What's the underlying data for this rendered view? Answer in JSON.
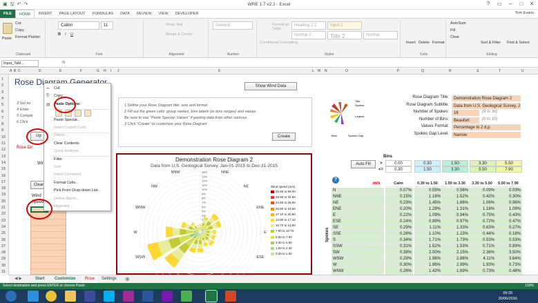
{
  "window": {
    "title": "WRE 1.7 v2.2 - Excel",
    "user": "Tom Evans"
  },
  "ribbon_tabs": [
    "FILE",
    "HOME",
    "INSERT",
    "PAGE LAYOUT",
    "FORMULAS",
    "DATA",
    "REVIEW",
    "VIEW",
    "DEVELOPER"
  ],
  "ribbon": {
    "cut": "Cut",
    "copy": "Copy",
    "paste": "Paste",
    "format_painter": "Format Painter",
    "font_name": "Calibri",
    "font_size": "11",
    "wrap_text": "Wrap Text",
    "merge": "Merge & Center",
    "number_format": "General",
    "conditional": "Conditional Formatting",
    "format_table": "Format as Table",
    "styles": [
      "Heading 2 2",
      "Input 2",
      "Normal 2",
      "Title 2",
      "Normal"
    ],
    "insert": "Insert",
    "delete": "Delete",
    "format": "Format",
    "autosum": "AutoSum",
    "fill": "Fill",
    "clear": "Clear",
    "sort_filter": "Sort & Filter",
    "find_select": "Find & Select",
    "groups": [
      "Clipboard",
      "Font",
      "Alignment",
      "Number",
      "Styles",
      "Cells",
      "Editing"
    ]
  },
  "formula_bar": {
    "name_box": "Input_Tabl...",
    "fx": "fx",
    "value": ""
  },
  "columns": [
    "A",
    "B",
    "C",
    "D",
    "E",
    "F",
    "G",
    "H",
    "I",
    "J",
    "K",
    "L",
    "M",
    "N",
    "O",
    "P",
    "Q",
    "R",
    "S",
    "T",
    "U"
  ],
  "rows": [
    "1",
    "2",
    "3",
    "4",
    "5",
    "6",
    "7",
    "8",
    "9",
    "10",
    "11",
    "12",
    "13",
    "14",
    "15",
    "16",
    "17",
    "18",
    "19",
    "20",
    "21",
    "22",
    "23",
    "24",
    "25",
    "26",
    "27",
    "28",
    "29",
    "30",
    "31"
  ],
  "sheet": {
    "title": "Rose Diagram Generator",
    "show_wind_data": "Show Wind Data",
    "left_instructions": [
      "3  Set nu",
      "4  Enter",
      "5  Comple",
      "6  Click"
    ],
    "update_button": "Up",
    "rose_dir_label": "Rose Dir",
    "wind_label": "Win",
    "clear_button": "Clear",
    "wind_header": "Wind",
    "speed_header": "Speed",
    "instructions": [
      "1  Define your Rose Diagram title, size and format",
      "2  Fill out the green cells: group names, bins labels (or bins ranges) and values",
      "    Be sure to use \"Paste Special: Values\" if pasting data from other sources",
      "3  Click \"Create\" to customize your Rose Diagram"
    ],
    "create_button": "Create"
  },
  "context_menu": {
    "items": [
      "Cut",
      "Copy",
      "Paste Options:",
      "",
      "Paste Special...",
      "Insert Copied Cells...",
      "Delete...",
      "Clear Contents",
      "Quick Analysis",
      "Filter",
      "Sort",
      "Insert Comment",
      "Format Cells...",
      "Pick From Drop-down List...",
      "Define Name...",
      "Hyperlink..."
    ],
    "disabled": [
      5,
      6,
      8,
      10,
      11,
      14,
      15
    ]
  },
  "settings": {
    "rows": [
      {
        "label": "Rose Diagram Title:",
        "value": "Demonstration Rose Diagram 2"
      },
      {
        "label": "Rose Diagram Subtitle:",
        "value": "Data from U.S. Geological Survey, Jan-01"
      },
      {
        "label": "Number of Spokes:",
        "value": "16",
        "hint": "(8 to 36)"
      },
      {
        "label": "Number of Bins:",
        "value": "Beaufort",
        "hint": "(0 to 10)"
      },
      {
        "label": "Values Format:",
        "value": "Percentage to 2 d.p."
      },
      {
        "label": "Spokes Gap Level:",
        "value": "Narrow"
      }
    ]
  },
  "bins": {
    "header": "Bins",
    "autofill": "Auto Fill",
    "gt": ">",
    "lte": "<=",
    "lower": [
      "0.00",
      "0.30",
      "1.50",
      "3.30",
      "5.50"
    ],
    "upper": [
      "0.30",
      "1.50",
      "3.30",
      "5.50",
      "7.90"
    ],
    "unit": "m/s",
    "columns": [
      "Calm",
      "0.30 to 1.50",
      "1.50 to 3.30",
      "3.30 to 5.50",
      "5.50 to 7.90"
    ],
    "spokes_label": "Spokes",
    "rows": [
      {
        "dir": "N",
        "v": [
          "0.07%",
          "0.55%",
          "0.56%",
          "0.09%",
          "0.03%"
        ]
      },
      {
        "dir": "NNE",
        "v": [
          "0.15%",
          "1.18%",
          "1.52%",
          "0.42%",
          "0.30%"
        ]
      },
      {
        "dir": "NE",
        "v": [
          "0.23%",
          "1.45%",
          "1.66%",
          "1.06%",
          "0.98%"
        ]
      },
      {
        "dir": "ENE",
        "v": [
          "0.20%",
          "1.29%",
          "1.31%",
          "1.18%",
          "1.09%"
        ]
      },
      {
        "dir": "E",
        "v": [
          "0.22%",
          "1.09%",
          "0.94%",
          "0.75%",
          "0.43%"
        ]
      },
      {
        "dir": "ESE",
        "v": [
          "0.24%",
          "0.89%",
          "0.97%",
          "0.72%",
          "0.47%"
        ]
      },
      {
        "dir": "SE",
        "v": [
          "0.29%",
          "1.11%",
          "1.33%",
          "0.63%",
          "0.27%"
        ]
      },
      {
        "dir": "SSE",
        "v": [
          "0.26%",
          "1.10%",
          "1.23%",
          "0.44%",
          "0.18%"
        ]
      },
      {
        "dir": "S",
        "v": [
          "0.34%",
          "1.71%",
          "1.73%",
          "0.53%",
          "0.53%"
        ]
      },
      {
        "dir": "SSW",
        "v": [
          "0.31%",
          "1.52%",
          "1.53%",
          "0.71%",
          "0.89%"
        ]
      },
      {
        "dir": "SW",
        "v": [
          "0.38%",
          "2.00%",
          "2.15%",
          "2.36%",
          "3.50%"
        ]
      },
      {
        "dir": "WSW",
        "v": [
          "0.29%",
          "1.98%",
          "2.88%",
          "4.11%",
          "3.64%"
        ]
      },
      {
        "dir": "W",
        "v": [
          "0.30%",
          "1.86%",
          "2.99%",
          "1.93%",
          "0.73%"
        ]
      },
      {
        "dir": "WNW",
        "v": [
          "0.26%",
          "1.42%",
          "1.69%",
          "0.73%",
          "0.48%"
        ]
      }
    ]
  },
  "chart": {
    "title": "Demonstration Rose Diagram 2",
    "subtitle": "Data from U.S. Geological Survey, Jan-01-2015 to Dec-31-2015",
    "directions": [
      "N",
      "NNE",
      "NE",
      "ENE",
      "E",
      "ESE",
      "SE",
      "SSE",
      "S",
      "SSW",
      "SW",
      "WSW",
      "W",
      "WNW",
      "NW",
      "NNW"
    ],
    "rings": [
      "14%",
      "13%",
      "12%",
      "11%",
      "10%",
      "9%",
      "8%",
      "7%",
      "6%",
      "5%",
      "4%",
      "3%",
      "2%",
      "1%",
      "0%"
    ],
    "legend_title": "Wind speed (m/s)",
    "legend": [
      {
        "label": "32.60 to 99.00",
        "color": "#c00000"
      },
      {
        "label": "28.50 to 32.60",
        "color": "#e53935"
      },
      {
        "label": "24.50 to 28.50",
        "color": "#f4511e"
      },
      {
        "label": "20.80 to 24.50",
        "color": "#fb8c00"
      },
      {
        "label": "17.10 to 20.80",
        "color": "#ffb300"
      },
      {
        "label": "13.90 to 17.10",
        "color": "#fdd835"
      },
      {
        "label": "10.70 to 13.80",
        "color": "#e6ee9c"
      },
      {
        "label": "7.90 to 10.70",
        "color": "#c0ca33"
      },
      {
        "label": "5.50 to 7.90",
        "color": "#d4e157"
      },
      {
        "label": "3.30 to 5.50",
        "color": "#9ccc65"
      },
      {
        "label": "1.50 to 3.30",
        "color": "#aed581"
      },
      {
        "label": "0.30 to 1.50",
        "color": "#c5e1a5"
      }
    ],
    "spoke_lengths": [
      0.13,
      0.26,
      0.38,
      0.36,
      0.26,
      0.26,
      0.29,
      0.25,
      0.34,
      0.36,
      0.73,
      0.9,
      0.57,
      0.33,
      0.2,
      0.12
    ]
  },
  "thumbnail": {
    "labels": [
      "Title",
      "Spokes",
      "Legend",
      "Spokes Gap",
      "Bins"
    ]
  },
  "sheet_tabs": [
    "Start",
    "Customize",
    "Rose",
    "Settings"
  ],
  "status_text": "Select destination and press ENTER or choose Paste",
  "zoom": "100%",
  "clock": {
    "time": "09:26",
    "date": "20/06/2016"
  }
}
